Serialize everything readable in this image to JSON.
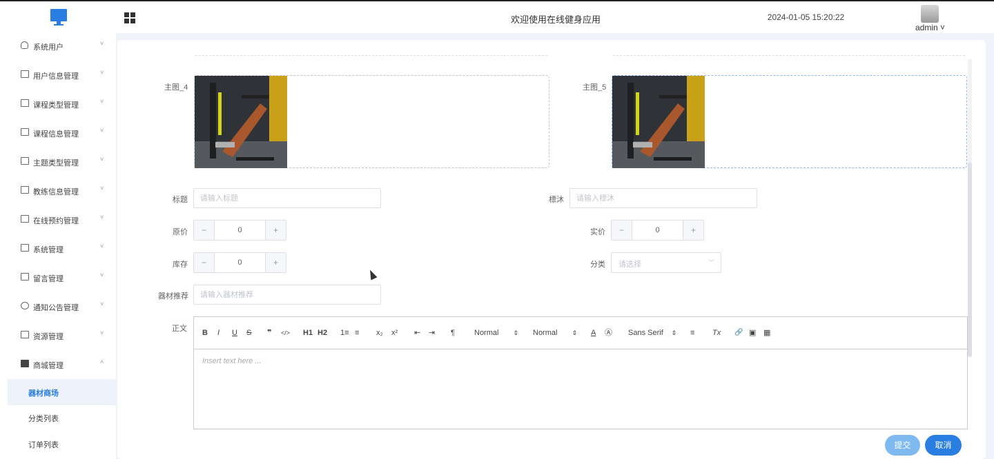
{
  "header": {
    "welcome": "欢迎使用在线健身应用",
    "datetime": "2024-01-05 15:20:22",
    "user": "admin ˅"
  },
  "sidebar": {
    "items": [
      {
        "label": "系统用户",
        "icon": "user-icon",
        "arrow": "˅"
      },
      {
        "label": "用户信息管理",
        "icon": "list-icon",
        "arrow": "˅"
      },
      {
        "label": "课程类型管理",
        "icon": "list-icon",
        "arrow": "˅"
      },
      {
        "label": "课程信息管理",
        "icon": "list-icon",
        "arrow": "˅"
      },
      {
        "label": "主题类型管理",
        "icon": "list-icon",
        "arrow": "˅"
      },
      {
        "label": "教练信息管理",
        "icon": "list-icon",
        "arrow": "˅"
      },
      {
        "label": "在线预约管理",
        "icon": "list-icon",
        "arrow": "˅"
      },
      {
        "label": "系统管理",
        "icon": "check-icon",
        "arrow": "˅"
      },
      {
        "label": "留言管理",
        "icon": "message-icon",
        "arrow": "˅"
      },
      {
        "label": "通知公告管理",
        "icon": "gear-icon",
        "arrow": "˅"
      },
      {
        "label": "资源管理",
        "icon": "printer-icon",
        "arrow": "˅"
      },
      {
        "label": "商城管理",
        "icon": "shop-icon",
        "arrow": "˄"
      }
    ],
    "subitems": [
      {
        "label": "器材商场",
        "active": true
      },
      {
        "label": "分类列表",
        "active": false
      },
      {
        "label": "订单列表",
        "active": false
      }
    ]
  },
  "form": {
    "image4_label": "主图_4",
    "image5_label": "主图_5",
    "title_label": "标题",
    "title_placeholder": "请输入标题",
    "tag_label": "標沐",
    "tag_placeholder": "请输入標沐",
    "original_price_label": "原价",
    "original_price_value": "0",
    "actual_price_label": "实价",
    "actual_price_value": "0",
    "stock_label": "库存",
    "stock_value": "0",
    "category_label": "分类",
    "category_placeholder": "请选择",
    "recommend_label": "器材推荐",
    "recommend_placeholder": "请输入器材推荐",
    "content_label": "正文",
    "stepper_minus": "−",
    "stepper_plus": "+"
  },
  "editor": {
    "toolbar": {
      "bold": "B",
      "italic": "I",
      "underline": "U",
      "strike": "S",
      "quote": "❞",
      "code": "</>",
      "h1": "H1",
      "h2": "H2",
      "ordered_list": "1≡",
      "bullet_list": "≡",
      "subscript": "x₂",
      "superscript": "x²",
      "outdent": "⇤",
      "indent": "⇥",
      "rtl": "¶",
      "size": "Normal",
      "header": "Normal",
      "color": "A",
      "background": "Ⓐ",
      "font": "Sans Serif",
      "align": "≡",
      "clean": "Tx",
      "link": "🔗",
      "image": "▣",
      "video": "▦"
    },
    "placeholder": "Insert text here ..."
  },
  "actions": {
    "submit": "提交",
    "cancel": "取消"
  }
}
